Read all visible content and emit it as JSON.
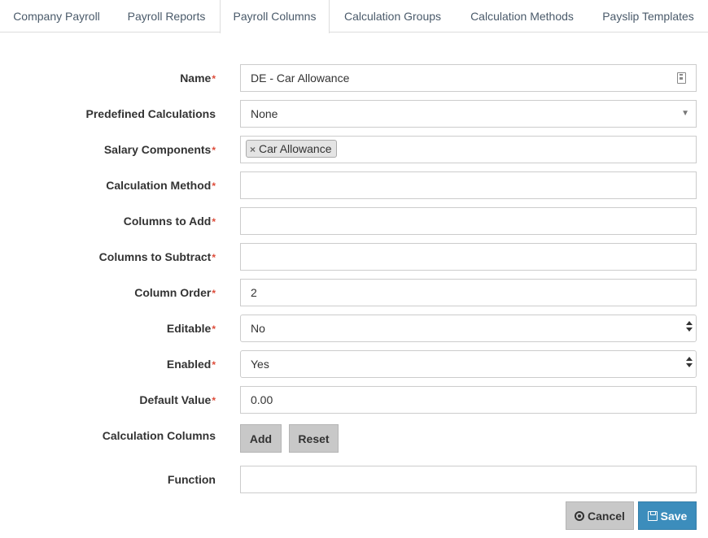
{
  "tabs": {
    "company_payroll": "Company Payroll",
    "payroll_reports": "Payroll Reports",
    "payroll_columns": "Payroll Columns",
    "calculation_groups": "Calculation Groups",
    "calculation_methods": "Calculation Methods",
    "payslip_templates": "Payslip Templates",
    "active": "Payroll Columns"
  },
  "form": {
    "required_mark": "*",
    "name": {
      "label": "Name",
      "value": "DE - Car Allowance"
    },
    "predefined_calculations": {
      "label": "Predefined Calculations",
      "value": "None"
    },
    "salary_components": {
      "label": "Salary Components",
      "chips": [
        "Car Allowance"
      ],
      "chip_remove": "×"
    },
    "calculation_method": {
      "label": "Calculation Method",
      "value": ""
    },
    "columns_to_add": {
      "label": "Columns to Add",
      "value": ""
    },
    "columns_to_subtract": {
      "label": "Columns to Subtract",
      "value": ""
    },
    "column_order": {
      "label": "Column Order",
      "value": "2"
    },
    "editable": {
      "label": "Editable",
      "value": "No"
    },
    "enabled": {
      "label": "Enabled",
      "value": "Yes"
    },
    "default_value": {
      "label": "Default Value",
      "value": "0.00"
    },
    "calculation_columns": {
      "label": "Calculation Columns",
      "add_label": "Add",
      "reset_label": "Reset"
    },
    "function": {
      "label": "Function",
      "value": ""
    }
  },
  "actions": {
    "cancel_label": "Cancel",
    "save_label": "Save"
  },
  "colors": {
    "required": "#dd4b39",
    "primary": "#3c8dbc",
    "secondary": "#c8c8c8",
    "tab_text": "#4a5a6a"
  },
  "icons": {
    "name_field": "document-icon",
    "predefined_select": "caret-down-icon",
    "spinner": "sort-icon",
    "cancel": "circle-x-icon",
    "save": "floppy-disk-icon"
  }
}
